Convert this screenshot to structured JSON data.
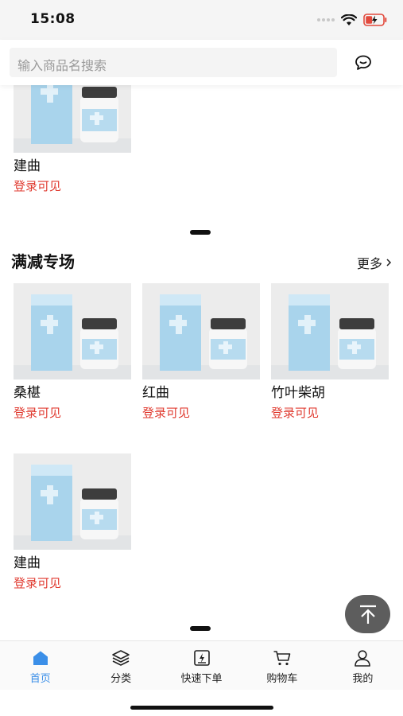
{
  "status_bar": {
    "time": "15:08"
  },
  "search": {
    "placeholder": "输入商品名搜索"
  },
  "top_section": {
    "products": [
      {
        "name": "建曲",
        "price_text": "登录可见"
      }
    ]
  },
  "promo_section": {
    "title": "满减专场",
    "more_label": "更多",
    "products": [
      {
        "name": "桑椹",
        "price_text": "登录可见"
      },
      {
        "name": "红曲",
        "price_text": "登录可见"
      },
      {
        "name": "竹叶柴胡",
        "price_text": "登录可见"
      },
      {
        "name": "建曲",
        "price_text": "登录可见"
      }
    ]
  },
  "tab_bar": {
    "items": [
      {
        "label": "首页",
        "icon": "home-icon",
        "active": true
      },
      {
        "label": "分类",
        "icon": "layers-icon",
        "active": false
      },
      {
        "label": "快速下单",
        "icon": "quick-order-icon",
        "active": false
      },
      {
        "label": "购物车",
        "icon": "cart-icon",
        "active": false
      },
      {
        "label": "我的",
        "icon": "user-icon",
        "active": false
      }
    ]
  },
  "colors": {
    "accent": "#3b8fe8",
    "price": "#e03a2f",
    "back_top": "#5d5d5d"
  }
}
